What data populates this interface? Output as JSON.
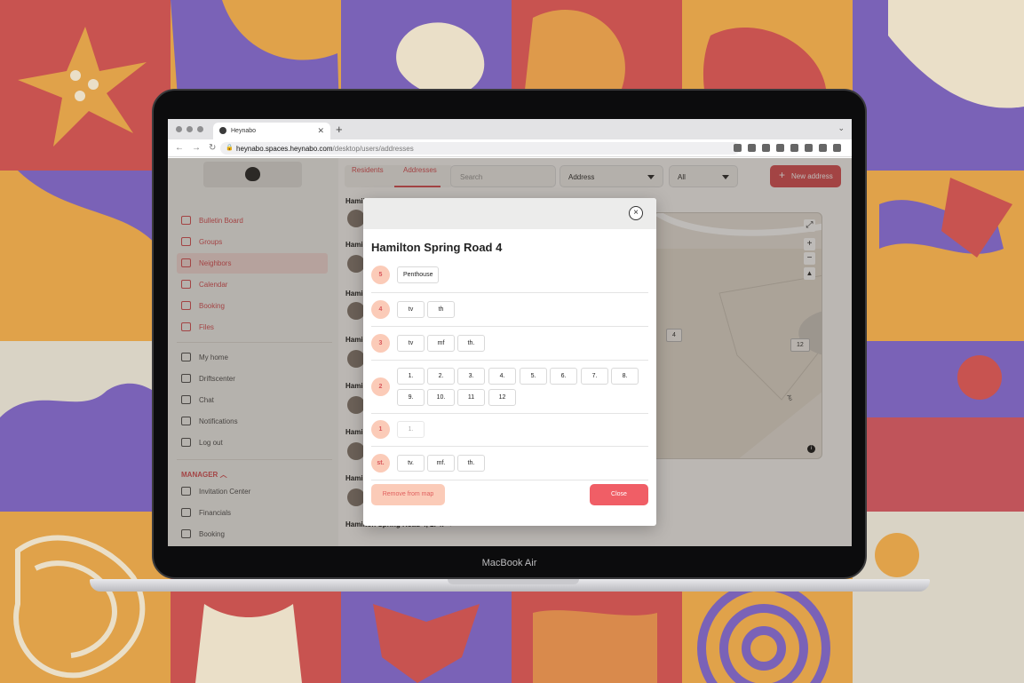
{
  "device": {
    "brand_label": "MacBook Air"
  },
  "browser": {
    "tab_title": "Heynabo",
    "url_host": "heynabo.spaces.heynabo.com",
    "url_path": "/desktop/users/addresses"
  },
  "sidebar": {
    "items": [
      {
        "label": "Bulletin Board",
        "icon": "bulletin-icon"
      },
      {
        "label": "Groups",
        "icon": "groups-icon"
      },
      {
        "label": "Neighbors",
        "icon": "neighbors-icon"
      },
      {
        "label": "Calendar",
        "icon": "calendar-icon"
      },
      {
        "label": "Booking",
        "icon": "booking-icon"
      },
      {
        "label": "Files",
        "icon": "files-icon"
      }
    ],
    "personal": [
      {
        "label": "My home",
        "icon": "home-icon"
      },
      {
        "label": "Driftscenter",
        "icon": "gear-icon"
      },
      {
        "label": "Chat",
        "icon": "chat-icon"
      },
      {
        "label": "Notifications",
        "icon": "bell-icon"
      },
      {
        "label": "Log out",
        "icon": "lock-icon"
      }
    ],
    "manager_label": "MANAGER",
    "manager_items": [
      {
        "label": "Invitation Center",
        "icon": "invite-icon"
      },
      {
        "label": "Financials",
        "icon": "financials-icon"
      },
      {
        "label": "Booking",
        "icon": "booking-icon"
      }
    ]
  },
  "toolbar": {
    "tabs": [
      "Residents",
      "Addresses"
    ],
    "active_tab": "Addresses",
    "search_placeholder": "Search",
    "address_select": "Address",
    "filter_select": "All",
    "new_button": "New address"
  },
  "list": {
    "headers": [
      "Hamil",
      "Hamil",
      "Hamil",
      "Hamil",
      "Hamil",
      "Hamil",
      "Hamil"
    ],
    "footer_header": "Hamilton Spring Road 4, 2. 4. →"
  },
  "map": {
    "labels": [
      "4",
      "12"
    ],
    "road_labels": [
      "Au"
    ],
    "zoom_in": "+",
    "zoom_out": "−",
    "info": "i"
  },
  "modal": {
    "title": "Hamilton Spring Road 4",
    "close_icon": "×",
    "floors": [
      {
        "floor": "5",
        "units": [
          "Penthouse"
        ]
      },
      {
        "floor": "4",
        "units": [
          "tv",
          "th"
        ]
      },
      {
        "floor": "3",
        "units": [
          "tv",
          "mf",
          "th."
        ]
      },
      {
        "floor": "2",
        "units": [
          "1.",
          "2.",
          "3.",
          "4.",
          "5.",
          "6.",
          "7.",
          "8.",
          "9.",
          "10.",
          "11",
          "12"
        ]
      },
      {
        "floor": "1",
        "units": [
          "1."
        ]
      },
      {
        "floor": "st.",
        "units": [
          "tv.",
          "mf.",
          "th."
        ]
      }
    ],
    "remove_button": "Remove from map",
    "close_button": "Close"
  },
  "colors": {
    "accent": "#d8555a",
    "floor_badge": "#fbcbb8",
    "close_button": "#f05e66"
  }
}
